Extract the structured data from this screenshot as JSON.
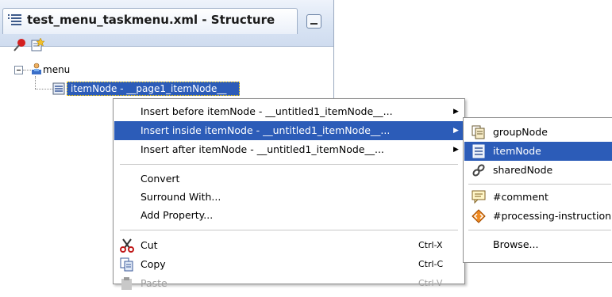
{
  "panel": {
    "title": "test_menu_taskmenu.xml - Structure",
    "icons": {
      "structure": "structure-icon",
      "pin": "pin-icon",
      "new": "new-view-icon",
      "minimize": "minimize-icon"
    }
  },
  "tree": {
    "root_label": "menu",
    "selected_label": "itemNode - __page1_itemNode__"
  },
  "context_menu": {
    "items": [
      {
        "label": "Insert before itemNode - __untitled1_itemNode__...",
        "has_submenu": true
      },
      {
        "label": "Insert inside itemNode - __untitled1_itemNode__...",
        "has_submenu": true,
        "highlighted": true
      },
      {
        "label": "Insert after itemNode - __untitled1_itemNode__...",
        "has_submenu": true
      },
      {
        "label": "Convert"
      },
      {
        "label": "Surround With..."
      },
      {
        "label": "Add Property..."
      },
      {
        "label": "Cut",
        "shortcut": "Ctrl-X",
        "icon": "scissors-icon"
      },
      {
        "label": "Copy",
        "shortcut": "Ctrl-C",
        "icon": "copy-icon"
      },
      {
        "label": "Paste",
        "shortcut": "Ctrl-V",
        "icon": "paste-icon",
        "disabled": true
      }
    ]
  },
  "submenu": {
    "items": [
      {
        "label": "groupNode",
        "icon": "group-node-icon"
      },
      {
        "label": "itemNode",
        "icon": "item-node-icon",
        "highlighted": true
      },
      {
        "label": "sharedNode",
        "icon": "shared-node-icon"
      },
      {
        "label": "#comment",
        "icon": "comment-icon"
      },
      {
        "label": "#processing-instruction",
        "icon": "processing-instruction-icon"
      },
      {
        "label": "Browse..."
      }
    ]
  },
  "colors": {
    "selection": "#2c5cb8",
    "panel_header": "#d8e3f3"
  }
}
